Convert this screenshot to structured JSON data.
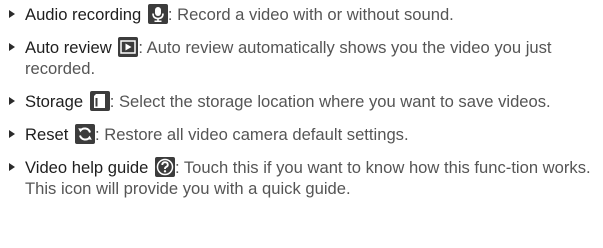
{
  "items": [
    {
      "term": "Audio recording",
      "icon": "microphone-icon",
      "description": ": Record a video with or without sound."
    },
    {
      "term": "Auto review",
      "icon": "play-review-icon",
      "description": ": Auto review automatically shows you the video you just recorded."
    },
    {
      "term": "Storage",
      "icon": "sd-card-icon",
      "description": ": Select the storage location where you want to save videos."
    },
    {
      "term": "Reset",
      "icon": "reset-arrows-icon",
      "description": ": Restore all video camera default settings."
    },
    {
      "term": "Video help guide",
      "icon": "help-question-icon",
      "description": ": Touch this if you want to know how this func-tion works. This icon will provide you with a quick guide."
    }
  ],
  "colors": {
    "text": "#555555",
    "term": "#1e1e1e",
    "icon_bg": "#3c3c3c",
    "icon_fg": "#ffffff",
    "bullet": "#2b2b2b"
  }
}
